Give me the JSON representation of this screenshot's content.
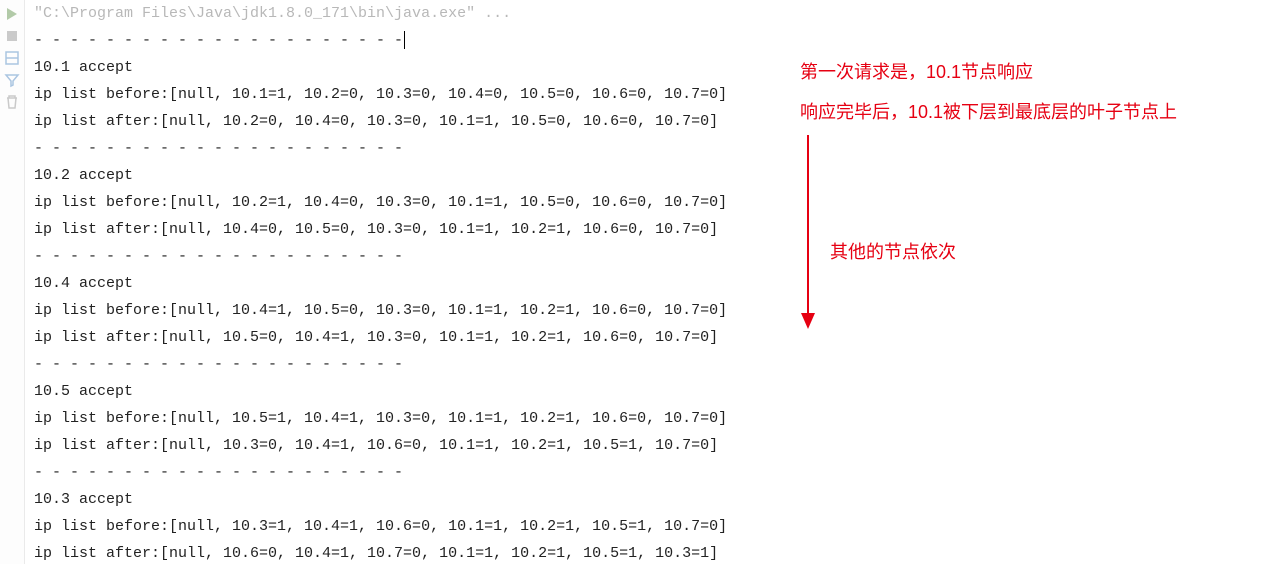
{
  "command_line": "\"C:\\Program Files\\Java\\jdk1.8.0_171\\bin\\java.exe\" ...",
  "separator": "- - - - - - - - - - - - - - - - - - - - -",
  "blocks": [
    {
      "accept": "10.1 accept",
      "before": "ip list before:[null, 10.1=1, 10.2=0, 10.3=0, 10.4=0, 10.5=0, 10.6=0, 10.7=0]",
      "after": "ip list after:[null, 10.2=0, 10.4=0, 10.3=0, 10.1=1, 10.5=0, 10.6=0, 10.7=0]"
    },
    {
      "accept": "10.2 accept",
      "before": "ip list before:[null, 10.2=1, 10.4=0, 10.3=0, 10.1=1, 10.5=0, 10.6=0, 10.7=0]",
      "after": "ip list after:[null, 10.4=0, 10.5=0, 10.3=0, 10.1=1, 10.2=1, 10.6=0, 10.7=0]"
    },
    {
      "accept": "10.4 accept",
      "before": "ip list before:[null, 10.4=1, 10.5=0, 10.3=0, 10.1=1, 10.2=1, 10.6=0, 10.7=0]",
      "after": "ip list after:[null, 10.5=0, 10.4=1, 10.3=0, 10.1=1, 10.2=1, 10.6=0, 10.7=0]"
    },
    {
      "accept": "10.5 accept",
      "before": "ip list before:[null, 10.5=1, 10.4=1, 10.3=0, 10.1=1, 10.2=1, 10.6=0, 10.7=0]",
      "after": "ip list after:[null, 10.3=0, 10.4=1, 10.6=0, 10.1=1, 10.2=1, 10.5=1, 10.7=0]"
    },
    {
      "accept": "10.3 accept",
      "before": "ip list before:[null, 10.3=1, 10.4=1, 10.6=0, 10.1=1, 10.2=1, 10.5=1, 10.7=0]",
      "after": "ip list after:[null, 10.6=0, 10.4=1, 10.7=0, 10.1=1, 10.2=1, 10.5=1, 10.3=1]"
    }
  ],
  "notes": {
    "n1": "第一次请求是，10.1节点响应",
    "n2": "响应完毕后，10.1被下层到最底层的叶子节点上",
    "n3": "其他的节点依次"
  },
  "gutter_icons": [
    "rerun-icon",
    "stop-icon",
    "layout-icon",
    "filter-icon",
    "trash-icon"
  ]
}
